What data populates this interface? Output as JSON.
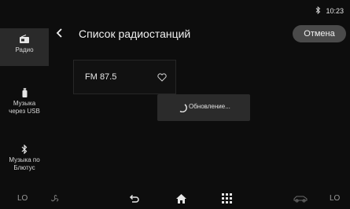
{
  "status": {
    "bluetooth_icon": "bluetooth-icon",
    "time": "10:23"
  },
  "sidebar": {
    "items": [
      {
        "label": "Радио",
        "icon": "radio-icon",
        "active": true
      },
      {
        "label": "Музыка через USB",
        "line1": "Музыка",
        "line2": "через USB",
        "icon": "usb-drive-icon"
      },
      {
        "label": "Музыка по Блютус",
        "line1": "Музыка по",
        "line2": "Блютус",
        "icon": "bluetooth-icon"
      }
    ]
  },
  "header": {
    "title": "Список радиостанций",
    "back_icon": "chevron-left-icon",
    "cancel_label": "Отмена"
  },
  "stations": [
    {
      "name": "FM 87.5",
      "favorite_icon": "heart-icon"
    }
  ],
  "toast": {
    "text": "Обновление...",
    "icon": "spinner-icon"
  },
  "bottom_bar": {
    "left_temp": "LO",
    "right_temp": "LO",
    "icons": [
      "fan-icon",
      "back-icon",
      "home-icon",
      "apps-grid-icon",
      "car-icon"
    ]
  },
  "colors": {
    "background": "#0d0d0d",
    "active_sidebar": "#2a2a2a",
    "button": "#4a4a4a",
    "toast": "#2b2b2b"
  }
}
